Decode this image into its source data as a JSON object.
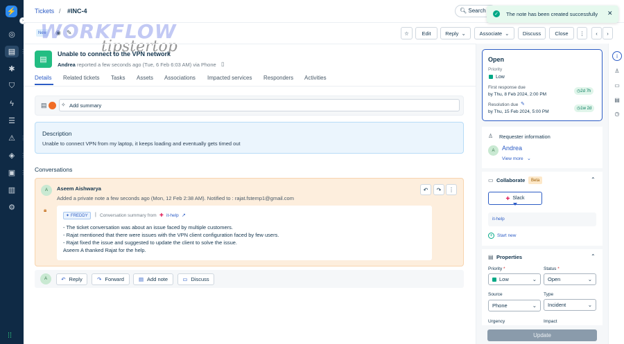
{
  "breadcrumb": {
    "tickets": "Tickets",
    "sep": "/",
    "ticket_id": "#INC-4"
  },
  "search": {
    "label": "Search"
  },
  "toast": {
    "message": "The note has been created successfully"
  },
  "toolbar": {
    "edit": "Edit",
    "reply": "Reply",
    "associate": "Associate",
    "discuss": "Discuss",
    "close": "Close"
  },
  "status_badge": "New",
  "watermark": {
    "line1": "WORKFLOW",
    "line2": "tipstertop"
  },
  "ticket": {
    "title": "Unable to connect to the VPN network",
    "requester": "Andrea",
    "meta": "reported a few seconds ago (Tue, 6 Feb 6:03 AM) via Phone"
  },
  "tabs": [
    "Details",
    "Related tickets",
    "Tasks",
    "Assets",
    "Associations",
    "Impacted services",
    "Responders",
    "Activities"
  ],
  "summary": {
    "add_label": "Add summary"
  },
  "description": {
    "heading": "Description",
    "text": "Unable to connect VPN from my laptop, it keeps loading and eventually gets timed out"
  },
  "conversations": {
    "heading": "Conversations",
    "note": {
      "avatar": "A",
      "author": "Aseem Aishwarya",
      "meta": "Added a private note a few seconds ago (Mon, 12 Feb 2:38 AM). Notified to : rajat.fstemp1@gmail.com",
      "freddy": "FREDDY",
      "sep": "|",
      "summary_from": "Conversation summary from",
      "channel": "it-help",
      "lines": [
        "- The ticket conversation was about an issue faced by multiple customers.",
        "- Rajat mentioned that there were issues with the VPN client configuration faced by few users.",
        "- Rajat fixed the issue and suggested to update the client to solve the issue.",
        "Aseem A thanked Rajat for the help."
      ]
    }
  },
  "reply_bar": {
    "avatar": "A",
    "reply": "Reply",
    "forward": "Forward",
    "add_note": "Add note",
    "discuss": "Discuss"
  },
  "status_card": {
    "status": "Open",
    "priority_label": "Priority",
    "priority_value": "Low",
    "first_response_label": "First response due",
    "first_response_value": "by Thu, 8 Feb 2024, 2:00 PM",
    "first_response_pill": "2d 7h",
    "resolution_label": "Resolution due",
    "resolution_value": "by Thu, 15 Feb 2024, 5:00 PM",
    "resolution_pill": "1w 2d"
  },
  "requester_info": {
    "heading": "Requester information",
    "avatar": "A",
    "name": "Andrea",
    "view_more": "View more"
  },
  "collaborate": {
    "heading": "Collaborate",
    "beta": "Beta",
    "slack": "Slack",
    "channel": "it-help",
    "start_new": "Start new"
  },
  "properties": {
    "heading": "Properties",
    "priority_label": "Priority",
    "priority_value": "Low",
    "status_label": "Status",
    "status_value": "Open",
    "source_label": "Source",
    "source_value": "Phone",
    "type_label": "Type",
    "type_value": "Incident",
    "urgency_label": "Urgency",
    "impact_label": "Impact",
    "required_mark": "*",
    "update": "Update"
  },
  "colors": {
    "accent": "#2c5cc5",
    "rail": "#0f2a45",
    "priority_low": "#00a886",
    "note_bg": "#fdeedd"
  }
}
